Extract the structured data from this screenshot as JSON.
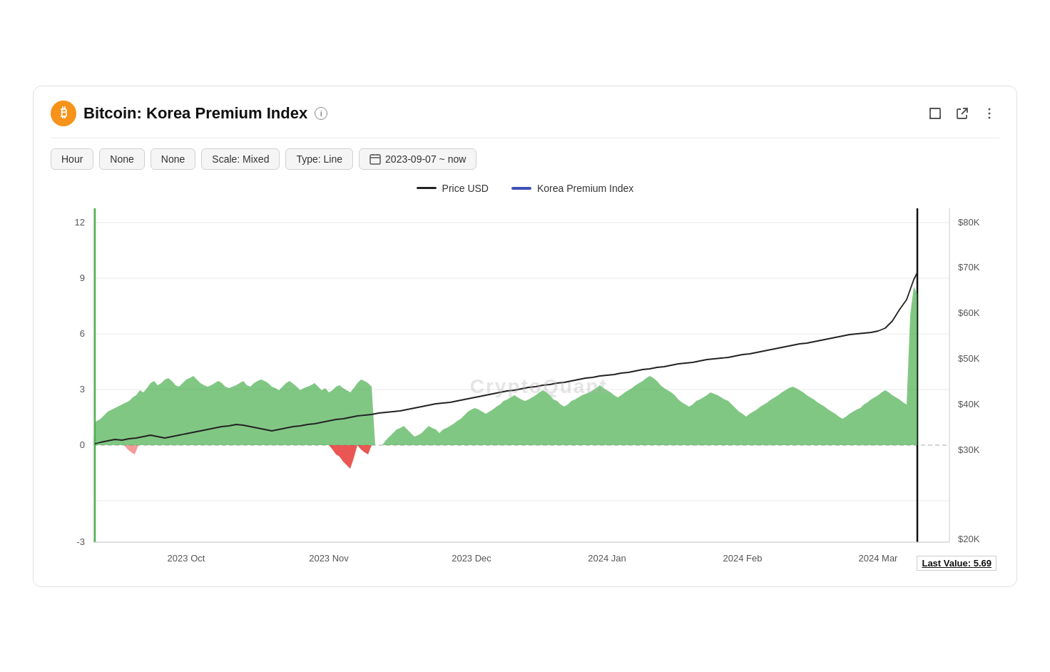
{
  "header": {
    "title": "Bitcoin: Korea Premium Index",
    "icon_label": "₿",
    "info_icon": "i"
  },
  "toolbar": {
    "btn1": "Hour",
    "btn2": "None",
    "btn3": "None",
    "btn4": "Scale: Mixed",
    "btn5": "Type: Line",
    "date_range": "2023-09-07 ~ now"
  },
  "legend": {
    "item1_label": "Price USD",
    "item1_color": "#111111",
    "item2_label": "Korea Premium Index",
    "item2_color": "#4040cc"
  },
  "chart": {
    "watermark": "CryptoQuant",
    "y_left_labels": [
      "12",
      "9",
      "6",
      "3",
      "0",
      "-3"
    ],
    "y_right_labels": [
      "$80K",
      "$70K",
      "$60K",
      "$50K",
      "$40K",
      "$30K",
      "$20K"
    ],
    "x_labels": [
      "2023 Oct",
      "2023 Nov",
      "2023 Dec",
      "2024 Jan",
      "2024 Feb",
      "2024 Mar"
    ],
    "last_value_label": "Last Value: 5.69",
    "colors": {
      "green_area": "#4caf50",
      "red_area": "#e53935",
      "price_line": "#222222",
      "kpi_line": "#3f51b5",
      "zero_line": "#999999",
      "vertical_green": "#4caf50",
      "vertical_black": "#111111"
    }
  },
  "icons": {
    "fullscreen": "⛶",
    "external_link": "↗",
    "more": "⋮",
    "calendar": "📅"
  }
}
